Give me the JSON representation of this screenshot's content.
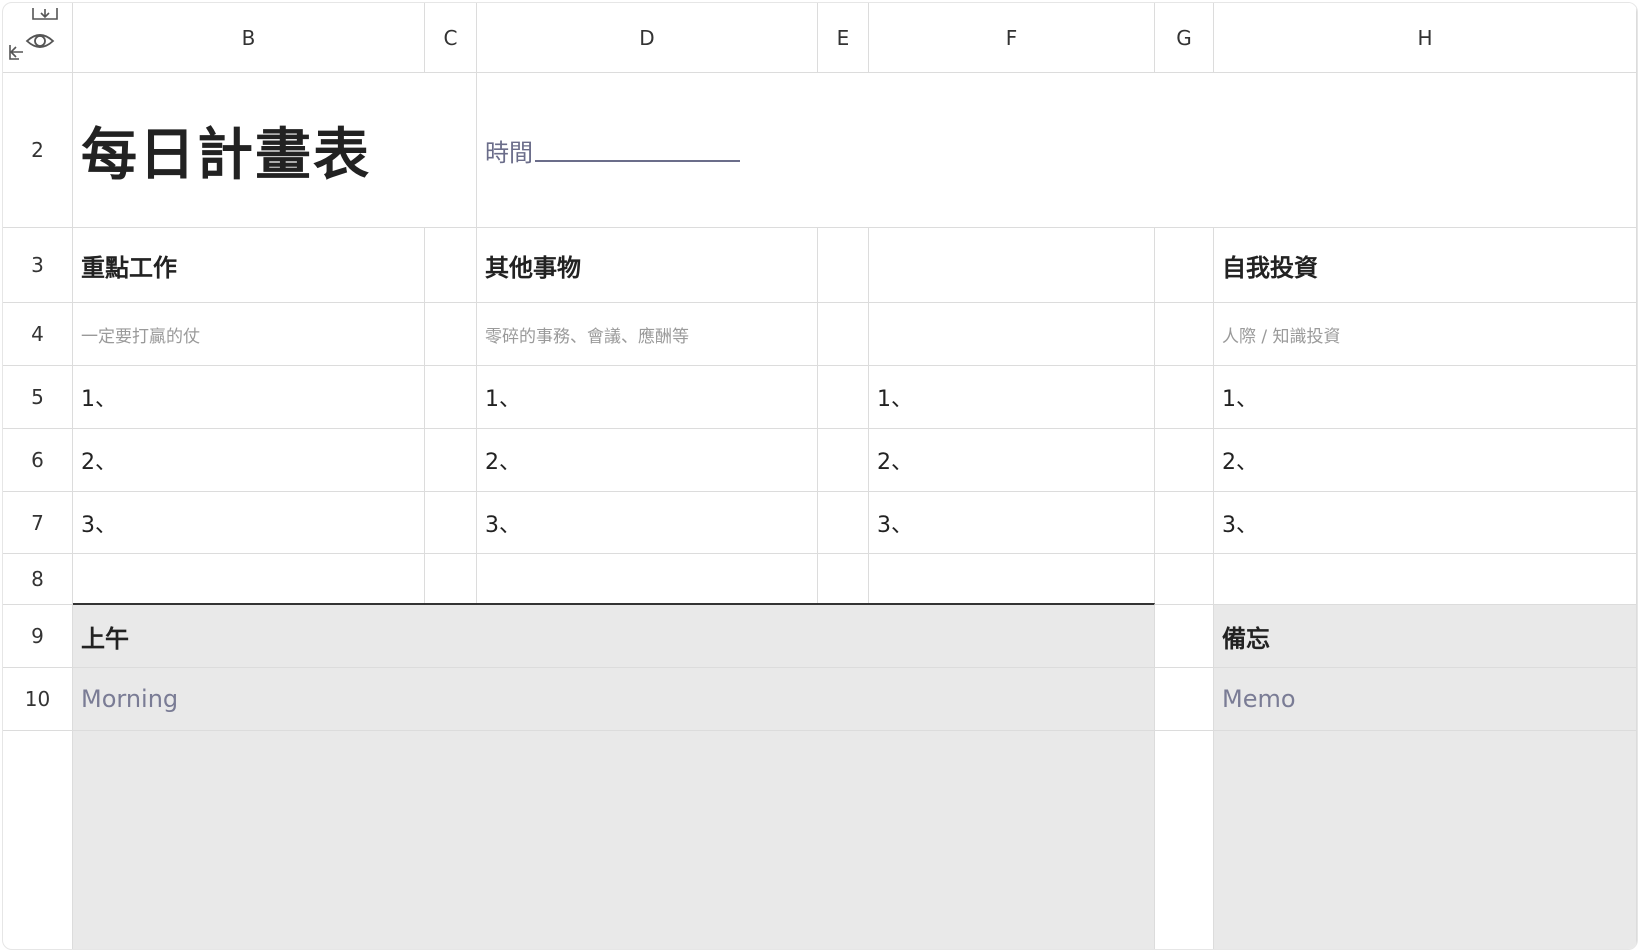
{
  "columns": {
    "B": "B",
    "C": "C",
    "D": "D",
    "E": "E",
    "F": "F",
    "G": "G",
    "H": "H"
  },
  "rows": {
    "r2": "2",
    "r3": "3",
    "r4": "4",
    "r5": "5",
    "r6": "6",
    "r7": "7",
    "r8": "8",
    "r9": "9",
    "r10": "10"
  },
  "icons": {
    "corner_left": "collapse-arrow-icon",
    "corner_eye": "eye-icon",
    "corner_download": "download-icon"
  },
  "cells": {
    "title": "每日計畫表",
    "time_label": "時間",
    "b3": "重點工作",
    "d3": "其他事物",
    "h3": "自我投資",
    "b4": "一定要打贏的仗",
    "d4": "零碎的事務、會議、應酬等",
    "h4": "人際 / 知識投資",
    "list": [
      "1、",
      "2、",
      "3、"
    ],
    "b9": "上午",
    "h9": "備忘",
    "b10": "Morning",
    "h10": "Memo"
  },
  "colors": {
    "gray_fill": "#e9e9e9",
    "muted_text": "#7a7c95",
    "grid_line": "#dcdcdc"
  }
}
